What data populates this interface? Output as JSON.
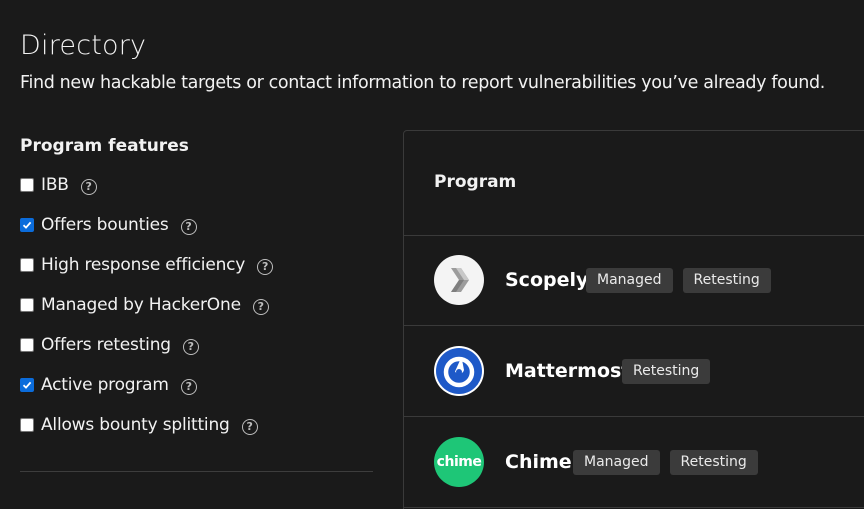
{
  "header": {
    "title": "Directory",
    "subtitle": "Find new hackable targets or contact information to report vulnerabilities you’ve already found."
  },
  "filters": {
    "heading": "Program features",
    "items": [
      {
        "label": "IBB",
        "checked": false
      },
      {
        "label": "Offers bounties",
        "checked": true
      },
      {
        "label": "High response efficiency",
        "checked": false
      },
      {
        "label": "Managed by HackerOne",
        "checked": false
      },
      {
        "label": "Offers retesting",
        "checked": false
      },
      {
        "label": "Active program",
        "checked": true
      },
      {
        "label": "Allows bounty splitting",
        "checked": false
      }
    ],
    "help_glyph": "?"
  },
  "table": {
    "column_header": "Program",
    "programs": [
      {
        "name": "Scopely",
        "logo": "scopely-logo",
        "badges": [
          "Managed",
          "Retesting"
        ]
      },
      {
        "name": "Mattermost",
        "logo": "mattermost-logo",
        "badges": [
          "Retesting"
        ]
      },
      {
        "name": "Chime",
        "logo": "chime-logo",
        "logo_text": "chime",
        "badges": [
          "Managed",
          "Retesting"
        ]
      }
    ]
  },
  "colors": {
    "background": "#1a1a1a",
    "checkbox_checked": "#0b6cdb",
    "badge_bg": "#3b3b3b",
    "chime_green": "#1ec677",
    "mattermost_blue": "#1e59c8"
  }
}
